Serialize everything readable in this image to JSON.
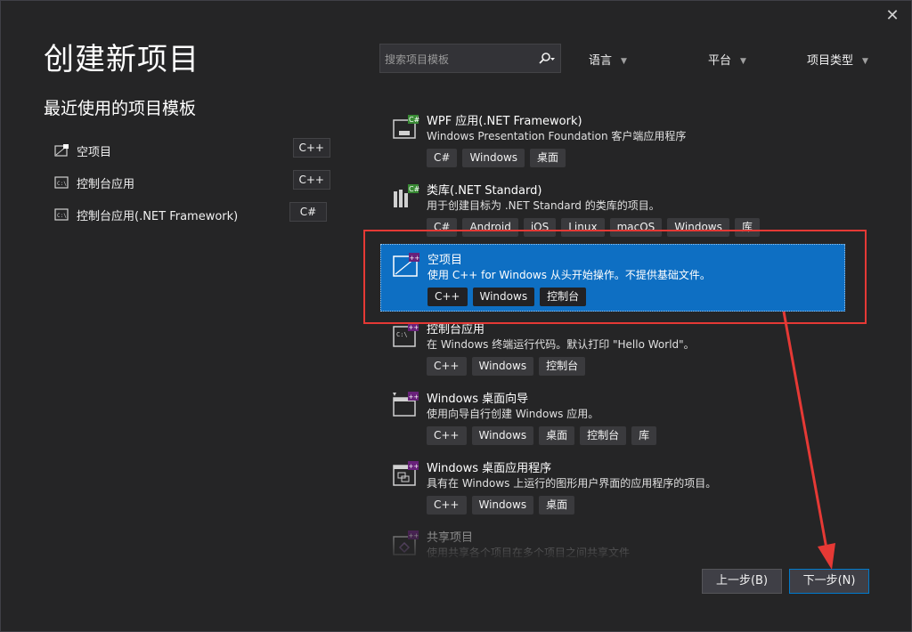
{
  "window": {
    "close_glyph": "✕"
  },
  "page_title": "创建新项目",
  "recent": {
    "title": "最近使用的项目模板",
    "items": [
      {
        "label": "空项目",
        "tag": "C++",
        "icon": "empty-project-icon"
      },
      {
        "label": "控制台应用",
        "tag": "C++",
        "icon": "console-app-icon"
      },
      {
        "label": "控制台应用(.NET Framework)",
        "tag": "C#",
        "icon": "console-app-icon"
      }
    ]
  },
  "search": {
    "placeholder": "搜索项目模板"
  },
  "filters": {
    "language": "语言",
    "platform": "平台",
    "project_type": "项目类型"
  },
  "templates": [
    {
      "name": "WPF 应用(.NET Framework)",
      "desc": "Windows Presentation Foundation 客户端应用程序",
      "tags": [
        "C#",
        "Windows",
        "桌面"
      ]
    },
    {
      "name": "类库(.NET Standard)",
      "desc": "用于创建目标为 .NET Standard 的类库的项目。",
      "tags": [
        "C#",
        "Android",
        "iOS",
        "Linux",
        "macOS",
        "Windows",
        "库"
      ]
    },
    {
      "name": "空项目",
      "desc": "使用 C++ for Windows 从头开始操作。不提供基础文件。",
      "tags": [
        "C++",
        "Windows",
        "控制台"
      ]
    },
    {
      "name": "控制台应用",
      "desc": "在 Windows 终端运行代码。默认打印 \"Hello World\"。",
      "tags": [
        "C++",
        "Windows",
        "控制台"
      ]
    },
    {
      "name": "Windows 桌面向导",
      "desc": "使用向导自行创建 Windows 应用。",
      "tags": [
        "C++",
        "Windows",
        "桌面",
        "控制台",
        "库"
      ]
    },
    {
      "name": "Windows 桌面应用程序",
      "desc": "具有在 Windows 上运行的图形用户界面的应用程序的项目。",
      "tags": [
        "C++",
        "Windows",
        "桌面"
      ]
    },
    {
      "name": "共享项目",
      "desc": "使用共享各个项目在多个项目之间共享文件",
      "tags": []
    }
  ],
  "buttons": {
    "back": "上一步(B)",
    "next": "下一步(N)"
  },
  "colors": {
    "selected": "#0e6fc3",
    "annotation": "#e53935",
    "accent": "#007acc"
  }
}
